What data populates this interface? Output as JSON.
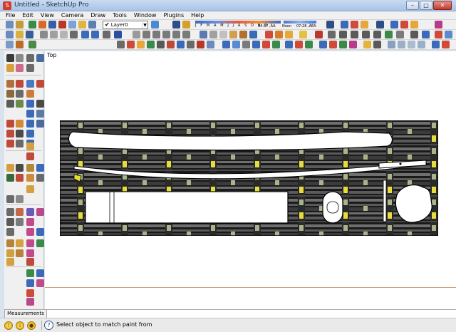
{
  "window": {
    "title": "Untitled - SketchUp Pro",
    "app_icon": "sketchup-logo-icon",
    "buttons": [
      "minimize",
      "maximize",
      "close"
    ]
  },
  "menubar": {
    "items": [
      "File",
      "Edit",
      "View",
      "Camera",
      "Draw",
      "Tools",
      "Window",
      "Plugins",
      "Help"
    ]
  },
  "toolbar": {
    "layer_check": "✔",
    "layer_name": "Layer0",
    "months_letters": "J F M A M J J A S O N D",
    "sunrise_time": "04:37 ,ÄÀ",
    "noon_label": "Noon",
    "sunset_time": "07:28 ,ÄÉA"
  },
  "viewport": {
    "scene_label": "Top",
    "colors": {
      "mat_dark": "#1a1a1a",
      "weave_light": "#6f6f6f",
      "weave_mid": "#3b3b3b",
      "accent_yellow": "#e6dc3a",
      "accent_sage": "#a9b48a",
      "object_fill": "#ffffff",
      "object_stroke": "#000000",
      "ground_line": "#c8a27d"
    }
  },
  "measurements": {
    "label": "Measurements",
    "value": ""
  },
  "status": {
    "buttons": [
      "geo-location-icon",
      "credits-icon",
      "user-icon"
    ],
    "help_icon": "question-icon",
    "message": "Select object to match paint from"
  }
}
